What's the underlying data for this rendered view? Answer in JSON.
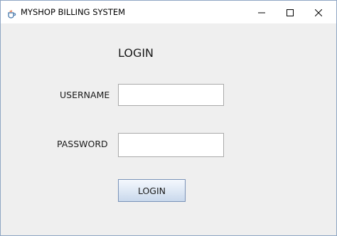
{
  "window": {
    "title": "MYSHOP BILLING SYSTEM",
    "app_icon": "java-cup-icon",
    "controls": {
      "minimize_icon": "minimize-icon",
      "maximize_icon": "maximize-icon",
      "close_icon": "close-icon"
    }
  },
  "form": {
    "heading": "LOGIN",
    "username_label": "USERNAME",
    "username_value": "",
    "password_label": "PASSWORD",
    "password_value": "",
    "submit_label": "LOGIN"
  },
  "colors": {
    "window_bg": "#efefef",
    "titlebar_bg": "#ffffff",
    "window_border": "#8fa6c4",
    "button_border": "#7a93b8"
  }
}
